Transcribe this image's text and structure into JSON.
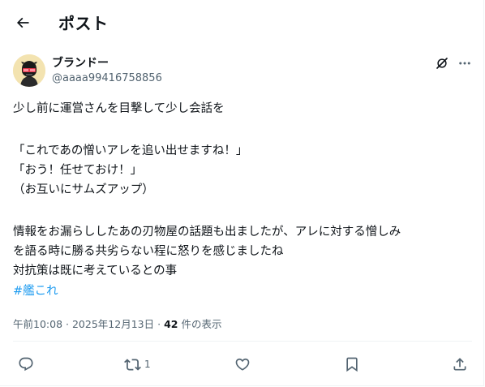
{
  "header": {
    "title": "ポスト"
  },
  "author": {
    "name": "ブランドー",
    "handle": "@aaaa99416758856"
  },
  "post": {
    "lines": [
      "少し前に運営さんを目撃して少し会話を",
      "「これであの憎いアレを追い出せますね！」",
      "「おう！任せておけ！」",
      "（お互いにサムズアップ）",
      "情報をお漏らししたあの刃物屋の話題も出ましたが、アレに対する憎しみ",
      "を語る時に勝る共劣らない程に怒りを感じましたね",
      "対抗策は既に考えているとの事"
    ],
    "hashtag": "#艦これ"
  },
  "meta": {
    "time": "午前10:08",
    "separator": "·",
    "date": "2025年12月13日",
    "views_count": "42",
    "views_label": "件の表示"
  },
  "actions": {
    "reply": "",
    "repost": "1",
    "like": "",
    "bookmark": "",
    "share": ""
  },
  "colors": {
    "text": "#0f1419",
    "secondary": "#536471",
    "link": "#1d9bf0",
    "divider": "#eff3f4"
  },
  "icons": [
    "back-arrow-icon",
    "grok-icon",
    "more-icon",
    "reply-icon",
    "repost-icon",
    "like-icon",
    "bookmark-icon",
    "share-icon"
  ]
}
